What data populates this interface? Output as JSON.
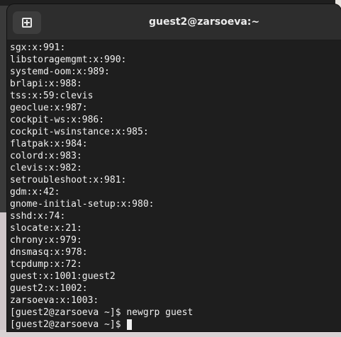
{
  "window": {
    "title": "guest2@zarsoeva:~"
  },
  "headerbar": {
    "new_tab_icon": "new-tab-icon"
  },
  "terminal": {
    "lines": [
      "sgx:x:991:",
      "libstoragemgmt:x:990:",
      "systemd-oom:x:989:",
      "brlapi:x:988:",
      "tss:x:59:clevis",
      "geoclue:x:987:",
      "cockpit-ws:x:986:",
      "cockpit-wsinstance:x:985:",
      "flatpak:x:984:",
      "colord:x:983:",
      "clevis:x:982:",
      "setroubleshoot:x:981:",
      "gdm:x:42:",
      "gnome-initial-setup:x:980:",
      "sshd:x:74:",
      "slocate:x:21:",
      "chrony:x:979:",
      "dnsmasq:x:978:",
      "tcpdump:x:72:",
      "guest:x:1001:guest2",
      "guest2:x:1002:",
      "zarsoeva:x:1003:",
      "[guest2@zarsoeva ~]$ newgrp guest"
    ],
    "current_prompt": "[guest2@zarsoeva ~]$ "
  },
  "colors": {
    "terminal_bg": "#1e1e1e",
    "terminal_fg": "#f0f0f0",
    "headerbar_bg": "#2d2d2d"
  }
}
